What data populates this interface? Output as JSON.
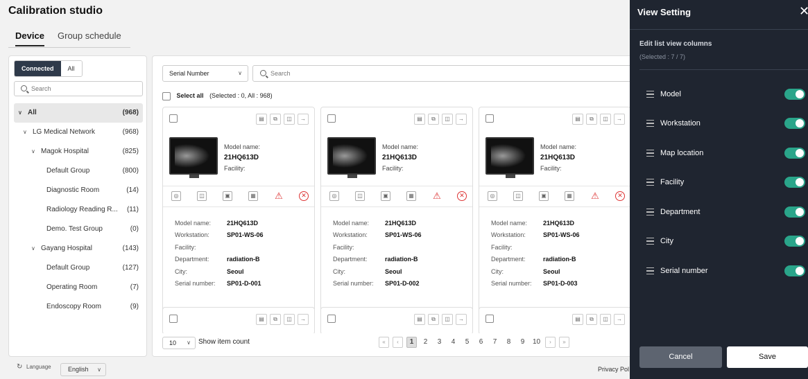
{
  "app": {
    "title": "Calibration studio"
  },
  "tabs": [
    {
      "label": "Device"
    },
    {
      "label": "Group schedule"
    }
  ],
  "filter": {
    "connected": "Connected",
    "all": "All",
    "search_placeholder": "Search"
  },
  "tree": [
    {
      "label": "All",
      "count": "(968)"
    },
    {
      "label": "LG Medical Network",
      "count": "(968)"
    },
    {
      "label": "Magok Hospital",
      "count": "(825)"
    },
    {
      "label": "Default Group",
      "count": "(800)"
    },
    {
      "label": "Diagnostic Room",
      "count": "(14)"
    },
    {
      "label": "Radiology Reading R...",
      "count": "(11)"
    },
    {
      "label": "Demo. Test Group",
      "count": "(0)"
    },
    {
      "label": "Gayang Hospital",
      "count": "(143)"
    },
    {
      "label": "Default Group",
      "count": "(127)"
    },
    {
      "label": "Operating Room",
      "count": "(7)"
    },
    {
      "label": "Endoscopy Room",
      "count": "(9)"
    }
  ],
  "main": {
    "sort_field": "Serial Number",
    "search_placeholder": "Search",
    "select_all": "Select all",
    "selection_status": "(Selected : 0, All : 968)"
  },
  "card_labels": {
    "model_name": "Model name:",
    "facility": "Facility:",
    "workstation": "Workstation:",
    "department": "Department:",
    "city": "City:",
    "serial_number": "Serial number:"
  },
  "devices": [
    {
      "model": "21HQ613D",
      "workstation": "SP01-WS-06",
      "facility": "",
      "department": "radiation-B",
      "city": "Seoul",
      "serial": "SP01-D-001"
    },
    {
      "model": "21HQ613D",
      "workstation": "SP01-WS-06",
      "facility": "",
      "department": "radiation-B",
      "city": "Seoul",
      "serial": "SP01-D-002"
    },
    {
      "model": "21HQ613D",
      "workstation": "SP01-WS-06",
      "facility": "",
      "department": "radiation-B",
      "city": "Seoul",
      "serial": "SP01-D-003"
    }
  ],
  "footer": {
    "item_count": "10",
    "show_item_count": "Show item count",
    "pages": [
      "1",
      "2",
      "3",
      "4",
      "5",
      "6",
      "7",
      "8",
      "9",
      "10"
    ],
    "current_page": "1"
  },
  "bottom": {
    "language_label": "Language",
    "language_value": "English",
    "privacy": "Privacy Pol"
  },
  "drawer": {
    "title": "View Setting",
    "subtitle": "Edit list view columns",
    "selected": "(Selected : 7 / 7)",
    "columns": [
      {
        "label": "Model",
        "enabled": true
      },
      {
        "label": "Workstation",
        "enabled": true
      },
      {
        "label": "Map location",
        "enabled": true
      },
      {
        "label": "Facility",
        "enabled": true
      },
      {
        "label": "Department",
        "enabled": true
      },
      {
        "label": "City",
        "enabled": true
      },
      {
        "label": "Serial number",
        "enabled": true
      }
    ],
    "cancel": "Cancel",
    "save": "Save"
  },
  "colors": {
    "accent_dark": "#2f3a4a",
    "toggle_on": "#2aa58a",
    "drawer_bg": "#1f2530",
    "error": "#dd3333"
  }
}
